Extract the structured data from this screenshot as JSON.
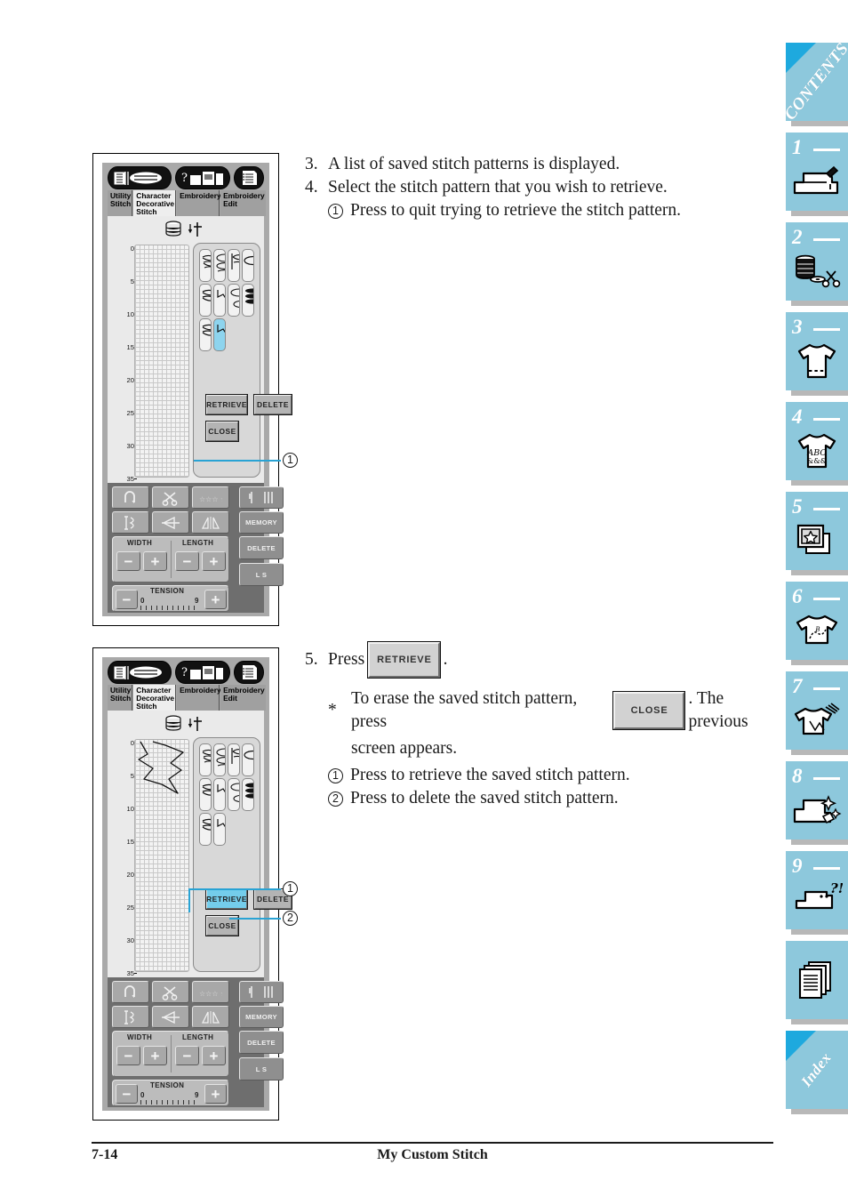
{
  "footer": {
    "page_number": "7-14",
    "chapter_title": "My Custom Stitch"
  },
  "sidebar": {
    "tabs": [
      {
        "label": "CONTENTS",
        "number": "",
        "icon": "contents-corner-icon",
        "type": "diagonal"
      },
      {
        "label": "",
        "number": "1",
        "icon": "sewing-machine-icon",
        "type": "numbered"
      },
      {
        "label": "",
        "number": "2",
        "icon": "spool-scissors-icon",
        "type": "numbered"
      },
      {
        "label": "",
        "number": "3",
        "icon": "tshirt-stitch-icon",
        "type": "numbered"
      },
      {
        "label": "",
        "number": "4",
        "icon": "tshirt-abc-icon",
        "type": "numbered"
      },
      {
        "label": "",
        "number": "5",
        "icon": "embroidery-card-star-icon",
        "type": "numbered"
      },
      {
        "label": "",
        "number": "6",
        "icon": "tshirt-monogram-icon",
        "type": "numbered"
      },
      {
        "label": "",
        "number": "7",
        "icon": "tshirt-needle-icon",
        "type": "numbered"
      },
      {
        "label": "",
        "number": "8",
        "icon": "machine-sparkle-icon",
        "type": "numbered"
      },
      {
        "label": "",
        "number": "9",
        "icon": "machine-question-icon",
        "type": "numbered"
      },
      {
        "label": "",
        "number": "",
        "icon": "pages-index-icon",
        "type": "icononly"
      },
      {
        "label": "Index",
        "number": "",
        "icon": "index-corner-icon",
        "type": "diagonal"
      }
    ]
  },
  "instructions": {
    "step3": {
      "num": "3.",
      "text": "A list of saved stitch patterns is displayed."
    },
    "step4": {
      "num": "4.",
      "text": "Select the stitch pattern that you wish to retrieve."
    },
    "step4_note1": {
      "marker": "1",
      "text": "Press to quit trying to retrieve the stitch pattern."
    },
    "step5": {
      "num": "5.",
      "prefix": "Press",
      "button": "RETRIEVE",
      "suffix": "."
    },
    "step5_star": {
      "marker": "*",
      "text_before": "To erase the saved stitch pattern, press",
      "button": "CLOSE",
      "text_after": ". The previous",
      "text_line2": "screen appears."
    },
    "step5_note1": {
      "marker": "1",
      "text": "Press to retrieve the saved stitch pattern."
    },
    "step5_note2": {
      "marker": "2",
      "text": "Press to delete the saved stitch pattern."
    }
  },
  "machine_ui": {
    "tabs": [
      {
        "line1": "Utility",
        "line2": "Stitch",
        "line3": "",
        "active": false
      },
      {
        "line1": "Character",
        "line2": "Decorative",
        "line3": "Stitch",
        "active": true
      },
      {
        "line1": "Embroidery",
        "line2": "",
        "line3": "",
        "active": false
      },
      {
        "line1": "Embroidery",
        "line2": "Edit",
        "line3": "",
        "active": false
      }
    ],
    "ruler_ticks": [
      "0",
      "5",
      "10",
      "15",
      "20",
      "25",
      "30",
      "35"
    ],
    "dialog_buttons": {
      "retrieve": "RETRIEVE",
      "delete": "DELETE",
      "close": "CLOSE"
    },
    "control_panel": {
      "width_label": "WIDTH",
      "length_label": "LENGTH",
      "tension_label": "TENSION",
      "tension_min": "0",
      "tension_max": "9",
      "memory_label": "MEMORY",
      "delete_label": "DELETE",
      "ls_label": "L  S",
      "minus": "−",
      "plus": "+"
    },
    "panel1": {
      "pattern_count": 10,
      "selected_index": 10,
      "highlighted_button": "",
      "canvas_has_preview": false
    },
    "panel2": {
      "pattern_count": 10,
      "selected_index": 0,
      "highlighted_button": "RETRIEVE",
      "canvas_has_preview": true
    }
  },
  "callouts": {
    "panel1": [
      {
        "marker": "1",
        "target": "close-button"
      }
    ],
    "panel2": [
      {
        "marker": "1",
        "target": "retrieve-button"
      },
      {
        "marker": "2",
        "target": "delete-button"
      }
    ]
  },
  "colors": {
    "tab_blue": "#8dc8dc",
    "corner_blue": "#1ea9de",
    "leader_blue": "#29a3d4",
    "highlight_cyan": "#8dd4ee",
    "button_cyan": "#74cdeb"
  }
}
